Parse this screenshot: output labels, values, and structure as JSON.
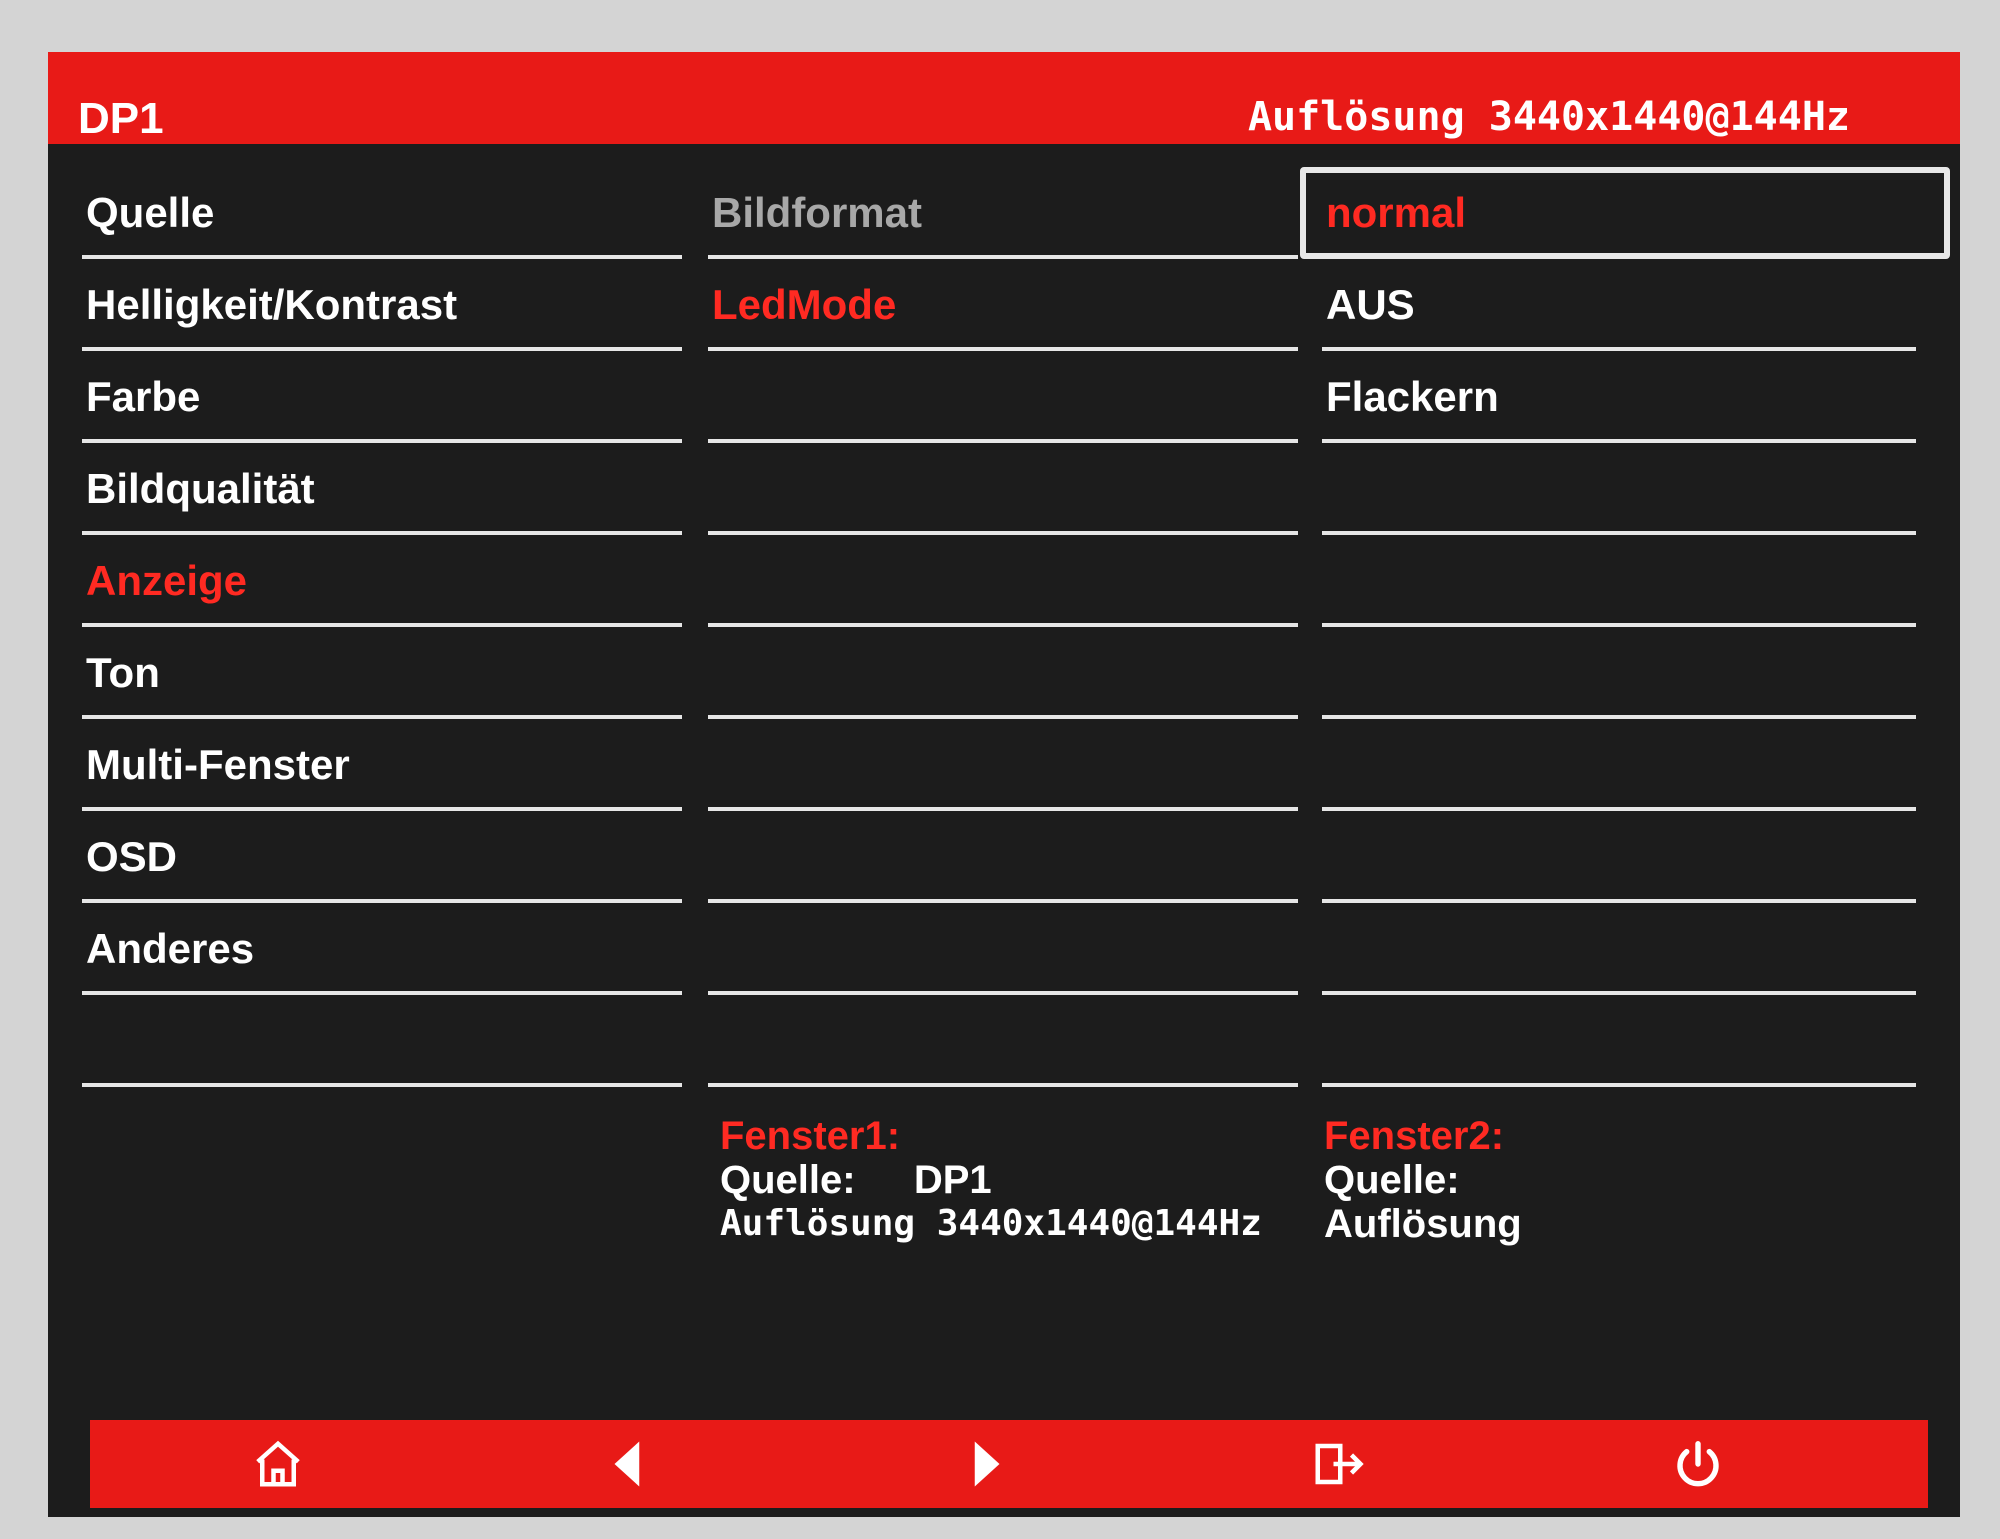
{
  "header": {
    "source": "DP1",
    "resolution": "Auflösung 3440x1440@144Hz"
  },
  "menu": {
    "items": [
      {
        "label": "Quelle"
      },
      {
        "label": "Helligkeit/Kontrast"
      },
      {
        "label": "Farbe"
      },
      {
        "label": "Bildqualität"
      },
      {
        "label": "Anzeige"
      },
      {
        "label": "Ton"
      },
      {
        "label": "Multi-Fenster"
      },
      {
        "label": "OSD"
      },
      {
        "label": "Anderes"
      },
      {
        "label": ""
      }
    ],
    "active": "Anzeige"
  },
  "submenu": {
    "items": [
      {
        "label": "Bildformat"
      },
      {
        "label": "LedMode"
      },
      {
        "label": ""
      },
      {
        "label": ""
      },
      {
        "label": ""
      },
      {
        "label": ""
      },
      {
        "label": ""
      },
      {
        "label": ""
      },
      {
        "label": ""
      },
      {
        "label": ""
      }
    ],
    "active": "LedMode"
  },
  "options": {
    "items": [
      {
        "label": "normal"
      },
      {
        "label": "AUS"
      },
      {
        "label": "Flackern"
      },
      {
        "label": ""
      },
      {
        "label": ""
      },
      {
        "label": ""
      },
      {
        "label": ""
      },
      {
        "label": ""
      },
      {
        "label": ""
      },
      {
        "label": ""
      }
    ],
    "selected": "normal"
  },
  "window1": {
    "title": "Fenster1:",
    "source_label": "Quelle:",
    "source_value": "DP1",
    "resolution": "Auflösung 3440x1440@144Hz"
  },
  "window2": {
    "title": "Fenster2:",
    "source_label": "Quelle:",
    "resolution": "Auflösung"
  },
  "nav": {
    "home": "home-icon",
    "left": "arrow-left-icon",
    "right": "arrow-right-icon",
    "exit": "exit-icon",
    "power": "power-icon"
  },
  "colors": {
    "accent": "#e81a17",
    "active_text": "#ff2a22",
    "background": "#1c1c1c"
  }
}
